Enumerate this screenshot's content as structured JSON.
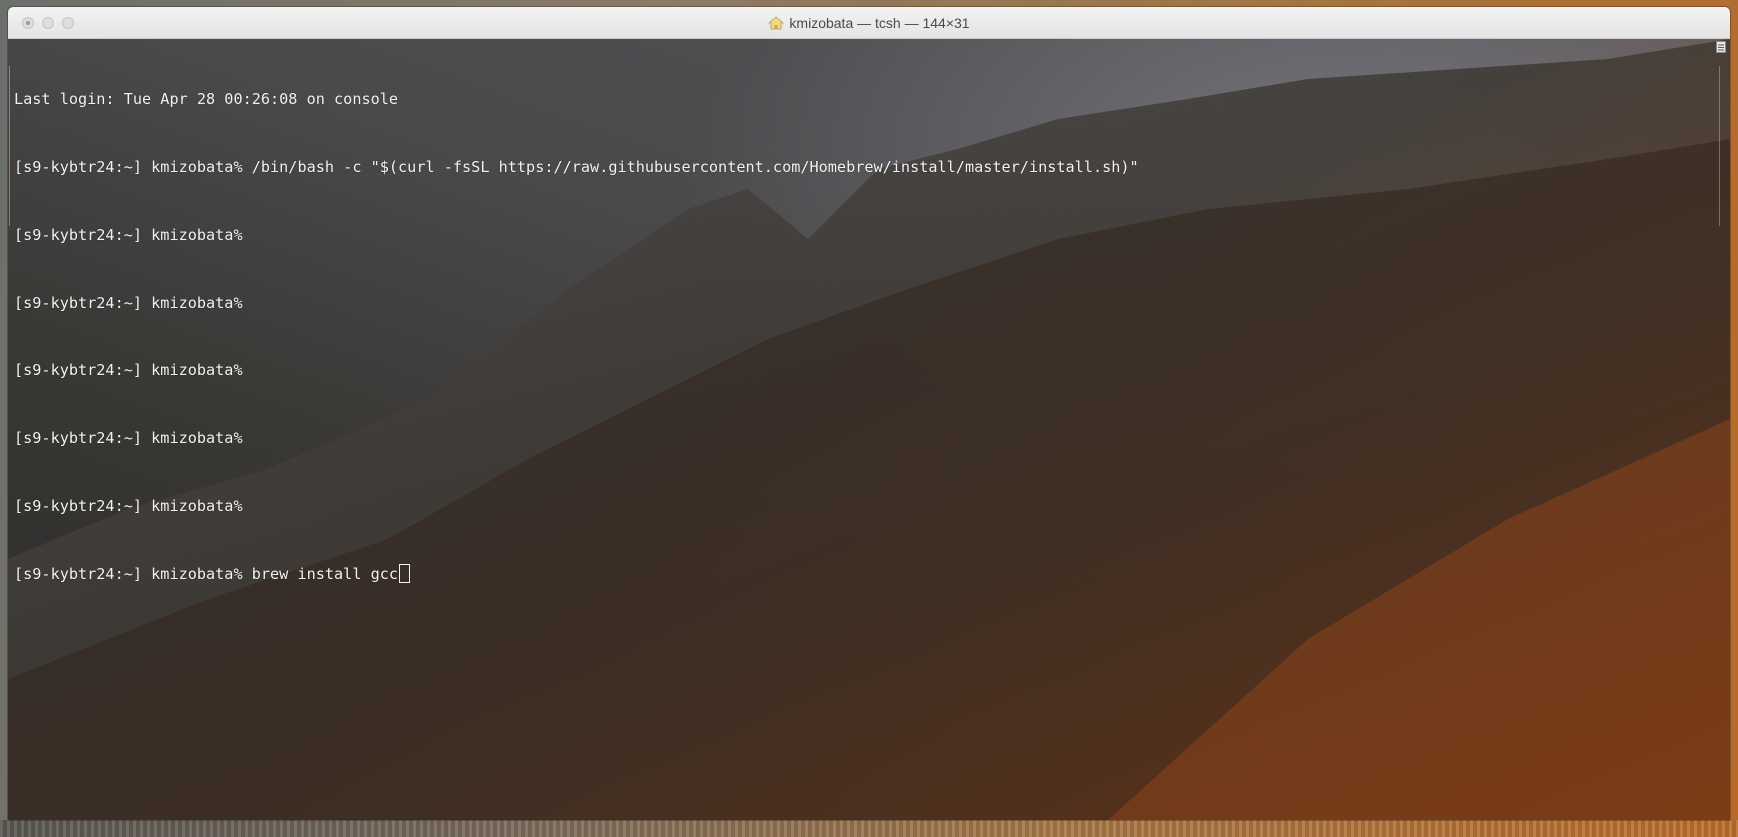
{
  "window": {
    "title": "kmizobata — tcsh — 144×31",
    "home_icon": "home-icon"
  },
  "terminal": {
    "lines": [
      "Last login: Tue Apr 28 00:26:08 on console",
      "[s9-kybtr24:~] kmizobata% /bin/bash -c \"$(curl -fsSL https://raw.githubusercontent.com/Homebrew/install/master/install.sh)\"",
      "[s9-kybtr24:~] kmizobata%",
      "[s9-kybtr24:~] kmizobata%",
      "[s9-kybtr24:~] kmizobata%",
      "[s9-kybtr24:~] kmizobata%",
      "[s9-kybtr24:~] kmizobata%",
      "[s9-kybtr24:~] kmizobata% brew install gcc"
    ],
    "text_color": "#f2f2f2",
    "cursor": "block-outline"
  },
  "icons": {
    "close": "close-icon",
    "minimize": "minimize-icon",
    "zoom": "zoom-icon",
    "scroll_indicator": "scroll-indicator-icon"
  }
}
